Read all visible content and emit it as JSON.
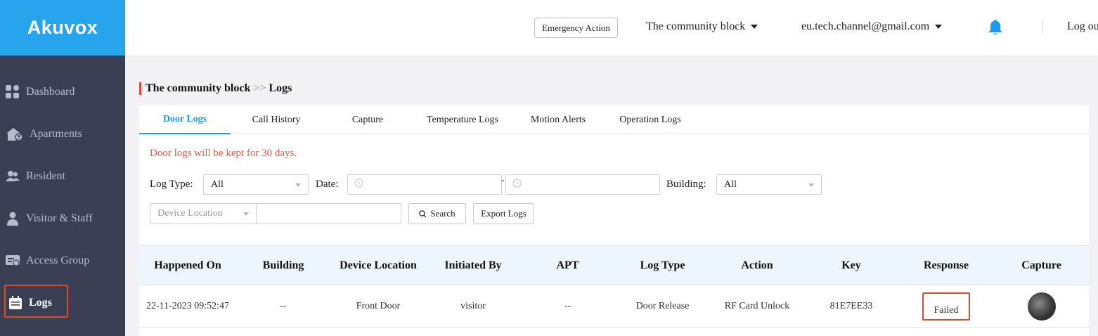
{
  "sidebar": {
    "logo": "Akuvox",
    "items": [
      {
        "label": "Dashboard",
        "icon": "dashboard-icon"
      },
      {
        "label": "Apartments",
        "icon": "apartments-icon"
      },
      {
        "label": "Resident",
        "icon": "resident-icon"
      },
      {
        "label": "Visitor & Staff",
        "icon": "visitor-staff-icon"
      },
      {
        "label": "Access Group",
        "icon": "access-group-icon"
      },
      {
        "label": "Logs",
        "icon": "logs-icon",
        "active": true
      }
    ]
  },
  "header": {
    "emergency_button": "Emergency Action",
    "community": "The community block",
    "account": "eu.tech.channel@gmail.com",
    "logout": "Log ou"
  },
  "breadcrumb": {
    "community": "The community block",
    "separator": ">>",
    "page": "Logs"
  },
  "tabs": [
    "Door Logs",
    "Call History",
    "Capture",
    "Temperature Logs",
    "Motion Alerts",
    "Operation Logs"
  ],
  "notice": "Door logs will be kept for 30 days.",
  "filters": {
    "log_type_label": "Log Type:",
    "log_type_value": "All",
    "date_label": "Date:",
    "date_separator": "-",
    "building_label": "Building:",
    "building_value": "All",
    "device_location_placeholder": "Device Location",
    "search_button": "Search",
    "export_button": "Export Logs"
  },
  "table": {
    "columns": [
      "Happened On",
      "Building",
      "Device Location",
      "Initiated By",
      "APT",
      "Log Type",
      "Action",
      "Key",
      "Response",
      "Capture"
    ],
    "rows": [
      [
        "22-11-2023 09:52:47",
        "--",
        "Front Door",
        "visitor",
        "--",
        "Door Release",
        "RF Card Unlock",
        "81E7EE33",
        "Failed",
        ""
      ]
    ]
  },
  "colors": {
    "brand_blue": "#27a4ec",
    "sidebar_bg": "#3b3f54",
    "accent_red": "#e0492e",
    "notice_red": "#ef5a4a",
    "tab_active": "#1b9af1"
  }
}
